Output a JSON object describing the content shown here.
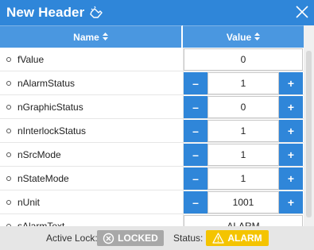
{
  "header": {
    "title": "New Header"
  },
  "table": {
    "columns": {
      "name": "Name",
      "value": "Value"
    },
    "rows": [
      {
        "name": "fValue",
        "value": "0",
        "stepper": false
      },
      {
        "name": "nAlarmStatus",
        "value": "1",
        "stepper": true
      },
      {
        "name": "nGraphicStatus",
        "value": "0",
        "stepper": true
      },
      {
        "name": "nInterlockStatus",
        "value": "1",
        "stepper": true
      },
      {
        "name": "nSrcMode",
        "value": "1",
        "stepper": true
      },
      {
        "name": "nStateMode",
        "value": "1",
        "stepper": true
      },
      {
        "name": "nUnit",
        "value": "1001",
        "stepper": true
      },
      {
        "name": "sAlarmText",
        "value": "ALARM",
        "stepper": false
      }
    ],
    "minus_label": "–",
    "plus_label": "+",
    "sort_glyph": "▲▼"
  },
  "footer": {
    "active_lock_label": "Active Lock:",
    "lock_state": "LOCKED",
    "status_label": "Status:",
    "status_value": "ALARM"
  },
  "colors": {
    "header_bg": "#2f86d9",
    "column_header_bg": "#4a97e0",
    "locked_badge": "#a8a8a8",
    "alarm_badge": "#f4c400"
  }
}
